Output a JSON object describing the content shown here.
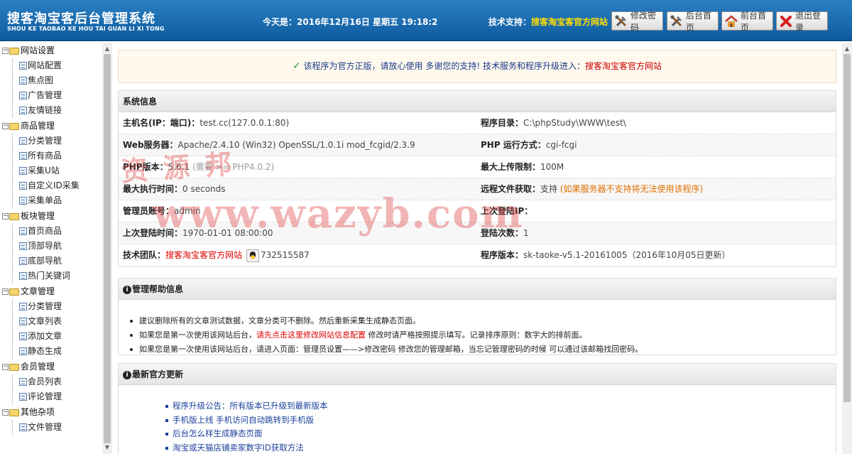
{
  "header": {
    "title_cn": "搜客淘宝客后台管理系统",
    "title_en": "SHOU KE TAOBAO KE HOU TAI GUAN LI XI TONG",
    "date_label": "今天是：",
    "date_value": "2016年12月16日 星期五 19:18:2",
    "support_label": "技术支持：",
    "support_link": "搜客淘宝客官方网站",
    "buttons": [
      {
        "label": "修改密码",
        "icon": "tools-icon"
      },
      {
        "label": "后台首页",
        "icon": "tools-icon"
      },
      {
        "label": "前台首页",
        "icon": "home-icon"
      },
      {
        "label": "退出登录",
        "icon": "exit-icon"
      }
    ]
  },
  "sidebar": {
    "groups": [
      {
        "label": "网站设置",
        "items": [
          "网站配置",
          "焦点图",
          "广告管理",
          "友情链接"
        ]
      },
      {
        "label": "商品管理",
        "items": [
          "分类管理",
          "所有商品",
          "采集U站",
          "自定义ID采集",
          "采集单品"
        ]
      },
      {
        "label": "板块管理",
        "items": [
          "首页商品",
          "顶部导航",
          "底部导航",
          "热门关键词"
        ]
      },
      {
        "label": "文章管理",
        "items": [
          "分类管理",
          "文章列表",
          "添加文章",
          "静态生成"
        ]
      },
      {
        "label": "会员管理",
        "items": [
          "会员列表",
          "评论管理"
        ]
      },
      {
        "label": "其他杂项",
        "items": [
          "文件管理"
        ]
      }
    ]
  },
  "notice": {
    "text": "该程序为官方正版，请放心使用 多谢您的支持! 技术服务和程序升级进入：",
    "link": "搜客淘宝客官方网站"
  },
  "sysinfo": {
    "title": "系统信息",
    "rows": [
      {
        "lk": "主机名(IP：端口)：",
        "lv": "test.cc(127.0.0.1:80)",
        "rk": "程序目录：",
        "rv": "C:\\phpStudy\\WWW\\test\\"
      },
      {
        "lk": "Web服务器：",
        "lv": "Apache/2.4.10 (Win32) OpenSSL/1.0.1i mod_fcgid/2.3.9",
        "rk": "PHP 运行方式：",
        "rv": "cgi-fcgi"
      },
      {
        "lk": "PHP版本：",
        "lv": "5.6.1",
        "lnote": "(需要 >= PHP4.0.2)",
        "rk": "最大上传限制：",
        "rv": "100M"
      },
      {
        "lk": "最大执行时间：",
        "lv": "0 seconds",
        "rk": "远程文件获取：",
        "rv": "支持",
        "rnote": "(如果服务器不支持将无法使用该程序)"
      },
      {
        "lk": "管理员账号：",
        "lv": "admin",
        "rk": "上次登陆IP：",
        "rv": ""
      },
      {
        "lk": "上次登陆时间：",
        "lv": "1970-01-01 08:00:00",
        "rk": "登陆次数：",
        "rv": "1"
      },
      {
        "lk": "技术团队：",
        "lv": "搜客淘宝客官方网站",
        "lqq": "732515587",
        "rk": "程序版本：",
        "rv": "sk-taoke-v5.1-20161005（2016年10月05日更新）"
      }
    ]
  },
  "help": {
    "title": "管理帮助信息",
    "items": [
      {
        "text": "建议删除所有的文章测试数据，文章分类可不删除。然后重新采集生成静态页面。"
      },
      {
        "pre": "如果您是第一次使用该网站后台，",
        "link": "请先点击这里修改网站信息配置",
        "post": " 修改时请严格按照提示填写。记录排序原则：数字大的排前面。"
      },
      {
        "text": "如果您是第一次使用该网站后台，请进入页面：管理员设置——>修改密码 修改您的管理邮箱，当忘记管理密码的时候 可以通过该邮箱找回密码。"
      }
    ]
  },
  "updates": {
    "title": "最新官方更新",
    "items": [
      "程序升级公告：所有版本已升级到最新版本",
      "手机版上线 手机访问自动跳转到手机版",
      "后台怎么样生成静态页面",
      "淘宝或天猫店铺卖家数字ID获取方法"
    ]
  },
  "watermark": {
    "line1": "资 源 邦",
    "line2": "www.wazyb.com"
  }
}
